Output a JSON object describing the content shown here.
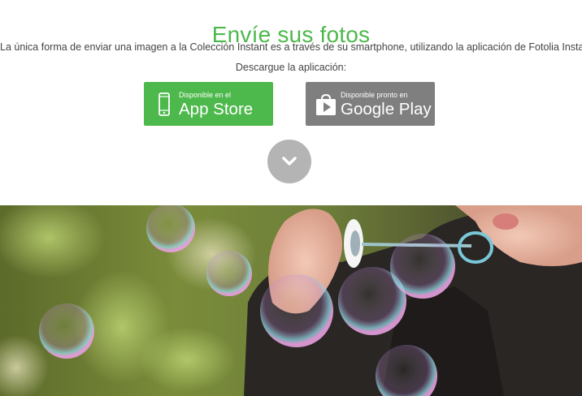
{
  "header": {
    "title": "Envíe sus fotos"
  },
  "intro": {
    "description": "La única forma de enviar una imagen a la Colección Instant es a través de su smartphone, utilizando la aplicación de Fotolia Instant.",
    "download_label": "Descargue la aplicación:"
  },
  "buttons": {
    "app_store": {
      "small": "Disponible en el",
      "big": "App Store",
      "color": "#4db84b",
      "icon": "phone-icon"
    },
    "google_play": {
      "small": "Disponible pronto en",
      "big": "Google Play",
      "color": "#7f7f7f",
      "icon": "play-store-icon"
    }
  },
  "scroll": {
    "icon": "chevron-down-icon",
    "color": "#b4b4b4"
  },
  "hero": {
    "description": "photo-child-blowing-bubbles"
  }
}
